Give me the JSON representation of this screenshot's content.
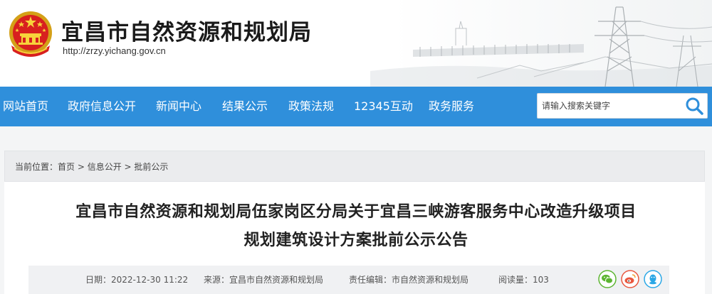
{
  "header": {
    "site_title": "宜昌市自然资源和规划局",
    "site_url": "http://zrzy.yichang.gov.cn"
  },
  "nav": {
    "items": [
      {
        "label": "网站首页"
      },
      {
        "label": "政府信息公开"
      },
      {
        "label": "新闻中心"
      },
      {
        "label": "结果公示"
      },
      {
        "label": "政策法规"
      },
      {
        "label": "12345互动"
      },
      {
        "label": "政务服务"
      }
    ],
    "search_placeholder": "请输入搜索关键字"
  },
  "breadcrumb": {
    "prefix": "当前位置：",
    "items": [
      "首页",
      "信息公开",
      "批前公示"
    ],
    "separator": " > "
  },
  "article": {
    "title_line1": "宜昌市自然资源和规划局伍家岗区分局关于宜昌三峡游客服务中心改造升级项目",
    "title_line2": "规划建筑设计方案批前公示公告",
    "date_label": "日期：",
    "date": "2022-12-30 11:22",
    "source_label": "来源：",
    "source": "宜昌市自然资源和规划局",
    "editor_label": "责任编辑：",
    "editor": "市自然资源和规划局",
    "views_label": "阅读量：",
    "views": "103"
  },
  "colors": {
    "nav_bg": "#2f8fdb",
    "wechat": "#5cb531",
    "weibo": "#e9573f",
    "qq": "#2aa7e6"
  },
  "icons": [
    "national-emblem",
    "search-icon",
    "wechat-icon",
    "weibo-icon",
    "qq-icon"
  ]
}
